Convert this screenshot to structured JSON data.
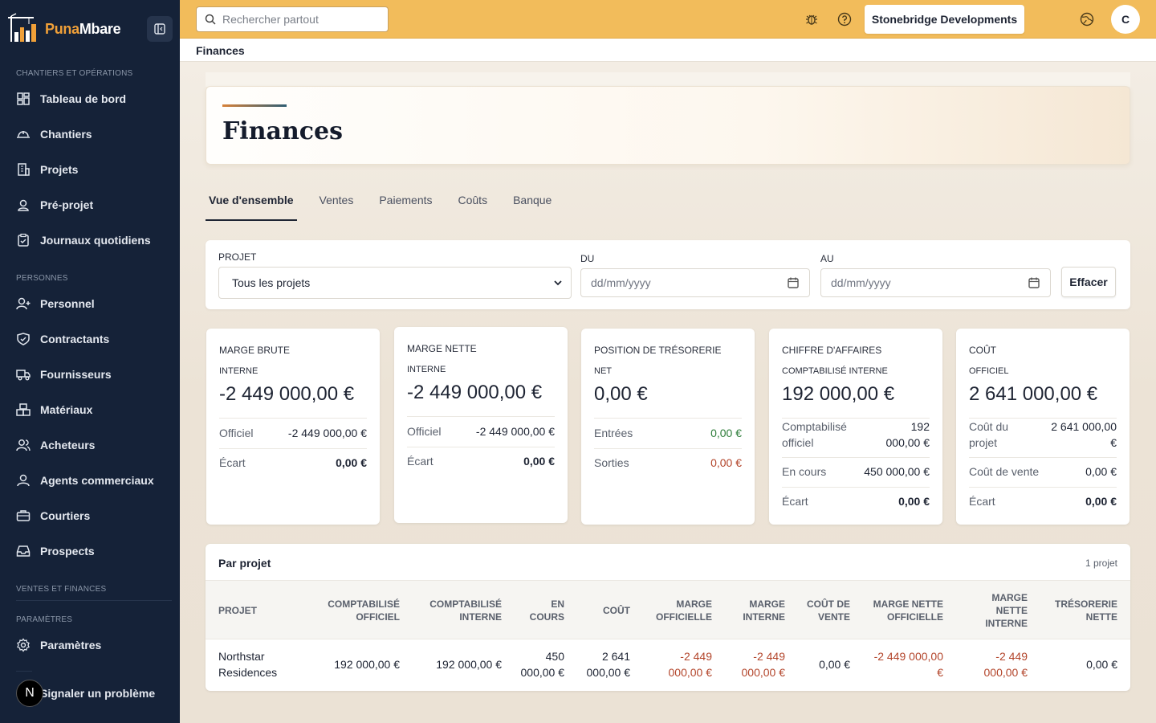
{
  "app": {
    "logo_part1": "Puna",
    "logo_part2": "Mbare"
  },
  "sidebar": {
    "sections": [
      {
        "label": "CHANTIERS ET OPÉRATIONS"
      },
      {
        "label": "PERSONNES"
      },
      {
        "label": "VENTES ET FINANCES"
      },
      {
        "label": "PARAMÈTRES"
      }
    ],
    "items": [
      {
        "label": "Tableau de bord",
        "icon": "dashboard-icon"
      },
      {
        "label": "Chantiers",
        "icon": "helmet-icon"
      },
      {
        "label": "Projets",
        "icon": "building-icon"
      },
      {
        "label": "Pré-projet",
        "icon": "user-pin-icon"
      },
      {
        "label": "Journaux quotidiens",
        "icon": "clipboard-icon"
      },
      {
        "label": "Personnel",
        "icon": "user-plus-icon"
      },
      {
        "label": "Contractants",
        "icon": "handshake-icon"
      },
      {
        "label": "Fournisseurs",
        "icon": "truck-icon"
      },
      {
        "label": "Matériaux",
        "icon": "boxes-icon"
      },
      {
        "label": "Acheteurs",
        "icon": "users-icon"
      },
      {
        "label": "Agents commerciaux",
        "icon": "user-icon"
      },
      {
        "label": "Courtiers",
        "icon": "briefcase-icon"
      },
      {
        "label": "Prospects",
        "icon": "inbox-icon"
      },
      {
        "label": "Paramètres",
        "icon": "gear-icon"
      }
    ],
    "report": {
      "avatar": "N",
      "label": "Signaler un problème"
    }
  },
  "topbar": {
    "search_placeholder": "Rechercher partout",
    "company": "Stonebridge Developments",
    "user_initial": "C"
  },
  "breadcrumb": "Finances",
  "page": {
    "title": "Finances",
    "tabs": [
      "Vue d'ensemble",
      "Ventes",
      "Paiements",
      "Coûts",
      "Banque"
    ],
    "active_tab": "Vue d'ensemble"
  },
  "filters": {
    "project_label": "PROJET",
    "project_value": "Tous les projets",
    "from_label": "DU",
    "from_placeholder": "dd/mm/yyyy",
    "to_label": "AU",
    "to_placeholder": "dd/mm/yyyy",
    "clear_label": "Effacer"
  },
  "cards": [
    {
      "label": "MARGE BRUTE",
      "sub": "INTERNE",
      "value": "-2 449 000,00 €",
      "rows": [
        {
          "k": "Officiel",
          "v": "-2 449 000,00 €"
        },
        {
          "k": "Écart",
          "v": "0,00 €"
        }
      ]
    },
    {
      "label": "MARGE NETTE",
      "sub": "INTERNE",
      "value": "-2 449 000,00 €",
      "rows": [
        {
          "k": "Officiel",
          "v": "-2 449 000,00 €"
        },
        {
          "k": "Écart",
          "v": "0,00 €"
        }
      ]
    },
    {
      "label": "POSITION DE TRÉSORERIE",
      "sub": "NET",
      "value": "0,00 €",
      "rows": [
        {
          "k": "Entrées",
          "v": "0,00 €"
        },
        {
          "k": "Sorties",
          "v": "0,00 €"
        }
      ]
    },
    {
      "label": "CHIFFRE D'AFFAIRES",
      "sub": "COMPTABILISÉ INTERNE",
      "value": "192 000,00 €",
      "rows": [
        {
          "k1": "Comptabilisé",
          "k2": "officiel",
          "v1": "192",
          "v2": "000,00 €"
        },
        {
          "k": "En cours",
          "v": "450 000,00 €"
        },
        {
          "k": "Écart",
          "v": "0,00 €"
        }
      ]
    },
    {
      "label": "COÛT",
      "sub": "OFFICIEL",
      "value": "2 641 000,00 €",
      "rows": [
        {
          "k1": "Coût du",
          "k2": "projet",
          "v1": "2 641 000,00",
          "v2": "€"
        },
        {
          "k": "Coût de vente",
          "v": "0,00 €"
        },
        {
          "k": "Écart",
          "v": "0,00 €"
        }
      ]
    }
  ],
  "table": {
    "title": "Par projet",
    "count": "1 projet",
    "headers": [
      [
        "PROJET"
      ],
      [
        "COMPTABILISÉ",
        "OFFICIEL"
      ],
      [
        "COMPTABILISÉ",
        "INTERNE"
      ],
      [
        "EN",
        "COURS"
      ],
      [
        "COÛT"
      ],
      [
        "MARGE",
        "OFFICIELLE"
      ],
      [
        "MARGE",
        "INTERNE"
      ],
      [
        "COÛT DE",
        "VENTE"
      ],
      [
        "MARGE NETTE",
        "OFFICIELLE"
      ],
      [
        "MARGE",
        "NETTE",
        "INTERNE"
      ],
      [
        "TRÉSORERIE",
        "NETTE"
      ]
    ],
    "rows": [
      {
        "project": [
          "Northstar",
          "Residences"
        ],
        "comptabilise_officiel": "192 000,00 €",
        "comptabilise_interne": "192 000,00 €",
        "en_cours": [
          "450",
          "000,00 €"
        ],
        "cout": [
          "2 641",
          "000,00 €"
        ],
        "marge_officielle": [
          "-2 449",
          "000,00 €"
        ],
        "marge_interne": [
          "-2 449",
          "000,00 €"
        ],
        "cout_de_vente": "0,00 €",
        "marge_nette_officielle": [
          "-2 449 000,00",
          "€"
        ],
        "marge_nette_interne": [
          "-2 449",
          "000,00 €"
        ],
        "tresorerie_nette": "0,00 €"
      }
    ]
  },
  "colors": {
    "sidebar_bg": "#152238",
    "topbar_bg": "#f2bc5b",
    "brand_accent": "#f0a038",
    "positive": "#2e7d3a",
    "negative": "#b3452b"
  }
}
